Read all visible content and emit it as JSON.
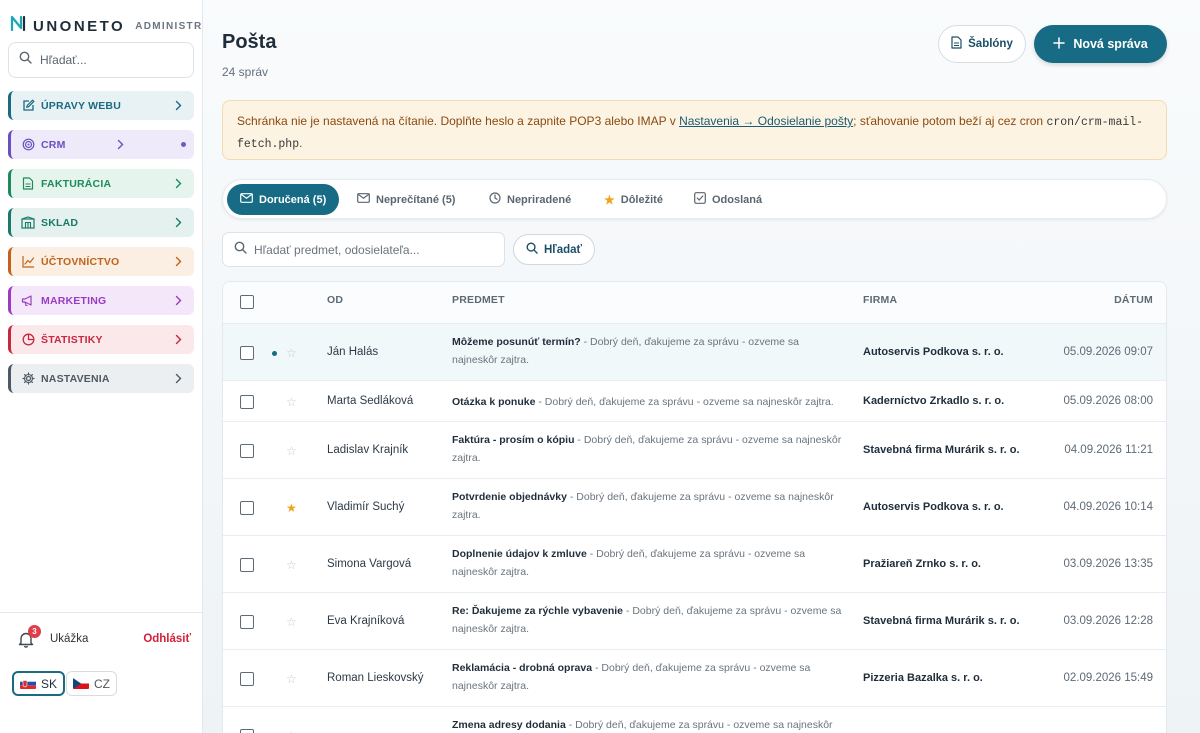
{
  "sidebar": {
    "brand_name": "UNONETO",
    "brand_sub": "ADMINISTR...",
    "search_placeholder": "Hľadať...",
    "items": [
      {
        "label": "ÚPRAVY WEBU",
        "color": "#1a6a80",
        "bg": "#e8f1f4",
        "icon": "edit-icon"
      },
      {
        "label": "CRM",
        "color": "#6a4fc0",
        "bg": "#eeeafa",
        "icon": "target-icon"
      },
      {
        "label": "FAKTURÁCIA",
        "color": "#1d8a5c",
        "bg": "#e6f4ee",
        "icon": "invoice-icon"
      },
      {
        "label": "SKLAD",
        "color": "#1a7a6a",
        "bg": "#e4f1ef",
        "icon": "warehouse-icon"
      },
      {
        "label": "ÚČTOVNÍCTVO",
        "color": "#c2621b",
        "bg": "#fbeee2",
        "icon": "chart-line-icon"
      },
      {
        "label": "MARKETING",
        "color": "#9b3bc4",
        "bg": "#f3e7f9",
        "icon": "megaphone-icon"
      },
      {
        "label": "ŠTATISTIKY",
        "color": "#c8283f",
        "bg": "#fbe8ea",
        "icon": "pie-chart-icon"
      },
      {
        "label": "NASTAVENIA",
        "color": "#4d5963",
        "bg": "#eceff2",
        "icon": "gear-icon"
      }
    ],
    "notification_count": "3",
    "user_name": "Ukážka",
    "logout_label": "Odhlásiť",
    "langs": [
      {
        "code": "SK",
        "active": true
      },
      {
        "code": "CZ",
        "active": false
      }
    ]
  },
  "header": {
    "title": "Pošta",
    "subtitle": "24 správ",
    "templates_label": "Šablóny",
    "new_message_label": "Nová správa"
  },
  "alert": {
    "text_before": "Schránka nie je nastavená na čítanie. Doplňte heslo a zapnite POP3 alebo IMAP v ",
    "link_text": "Nastavenia → Odosielanie pošty",
    "text_middle": "; sťahovanie potom beží aj cez cron ",
    "code": "cron/crm-mail-fetch.php",
    "text_after": "."
  },
  "tabs": [
    {
      "label": "Doručená (5)",
      "icon": "mail-icon",
      "active": true
    },
    {
      "label": "Neprečítané (5)",
      "icon": "mail-icon",
      "active": false
    },
    {
      "label": "Nepriradené",
      "icon": "clock-icon",
      "active": false
    },
    {
      "label": "Dôležité",
      "icon": "star-icon",
      "active": false
    },
    {
      "label": "Odoslaná",
      "icon": "check-square-icon",
      "active": false
    }
  ],
  "search": {
    "placeholder": "Hľadať predmet, odosielateľa...",
    "button_label": "Hľadať"
  },
  "table": {
    "columns": {
      "from": "OD",
      "subject": "PREDMET",
      "company": "FIRMA",
      "date": "DÁTUM"
    },
    "rows": [
      {
        "from": "Ján Halás",
        "subject": "Môžeme posunúť termín?",
        "preview": " - Dobrý deň, ďakujeme za správu - ozveme sa najneskôr zajtra.",
        "company": "Autoservis Podkova s. r. o.",
        "date": "05.09.2026 09:07",
        "unread": true,
        "starred": false
      },
      {
        "from": "Marta Sedláková",
        "subject": "Otázka k ponuke",
        "preview": " - Dobrý deň, ďakujeme za správu - ozveme sa najneskôr zajtra.",
        "company": "Kaderníctvo Zrkadlo s. r. o.",
        "date": "05.09.2026 08:00",
        "unread": false,
        "starred": false
      },
      {
        "from": "Ladislav Krajník",
        "subject": "Faktúra - prosím o kópiu",
        "preview": " - Dobrý deň, ďakujeme za správu - ozveme sa najneskôr zajtra.",
        "company": "Stavebná firma Murárik s. r. o.",
        "date": "04.09.2026 11:21",
        "unread": false,
        "starred": false
      },
      {
        "from": "Vladimír Suchý",
        "subject": "Potvrdenie objednávky",
        "preview": " - Dobrý deň, ďakujeme za správu - ozveme sa najneskôr zajtra.",
        "company": "Autoservis Podkova s. r. o.",
        "date": "04.09.2026 10:14",
        "unread": false,
        "starred": true
      },
      {
        "from": "Simona Vargová",
        "subject": "Doplnenie údajov k zmluve",
        "preview": " - Dobrý deň, ďakujeme za správu - ozveme sa najneskôr zajtra.",
        "company": "Pražiareň Zrnko s. r. o.",
        "date": "03.09.2026 13:35",
        "unread": false,
        "starred": false
      },
      {
        "from": "Eva Krajníková",
        "subject": "Re: Ďakujeme za rýchle vybavenie",
        "preview": " - Dobrý deň, ďakujeme za správu - ozveme sa najneskôr zajtra.",
        "company": "Stavebná firma Murárik s. r. o.",
        "date": "03.09.2026 12:28",
        "unread": false,
        "starred": false
      },
      {
        "from": "Roman Lieskovský",
        "subject": "Reklamácia - drobná oprava",
        "preview": " - Dobrý deň, ďakujeme za správu - ozveme sa najneskôr zajtra.",
        "company": "Pizzeria Bazalka s. r. o.",
        "date": "02.09.2026 15:49",
        "unread": false,
        "starred": false
      },
      {
        "from": "",
        "subject": "Zmena adresy dodania",
        "preview": " - Dobrý deň, ďakujeme za správu - ozveme sa najneskôr",
        "company": "",
        "date": "",
        "unread": false,
        "starred": false
      }
    ]
  }
}
